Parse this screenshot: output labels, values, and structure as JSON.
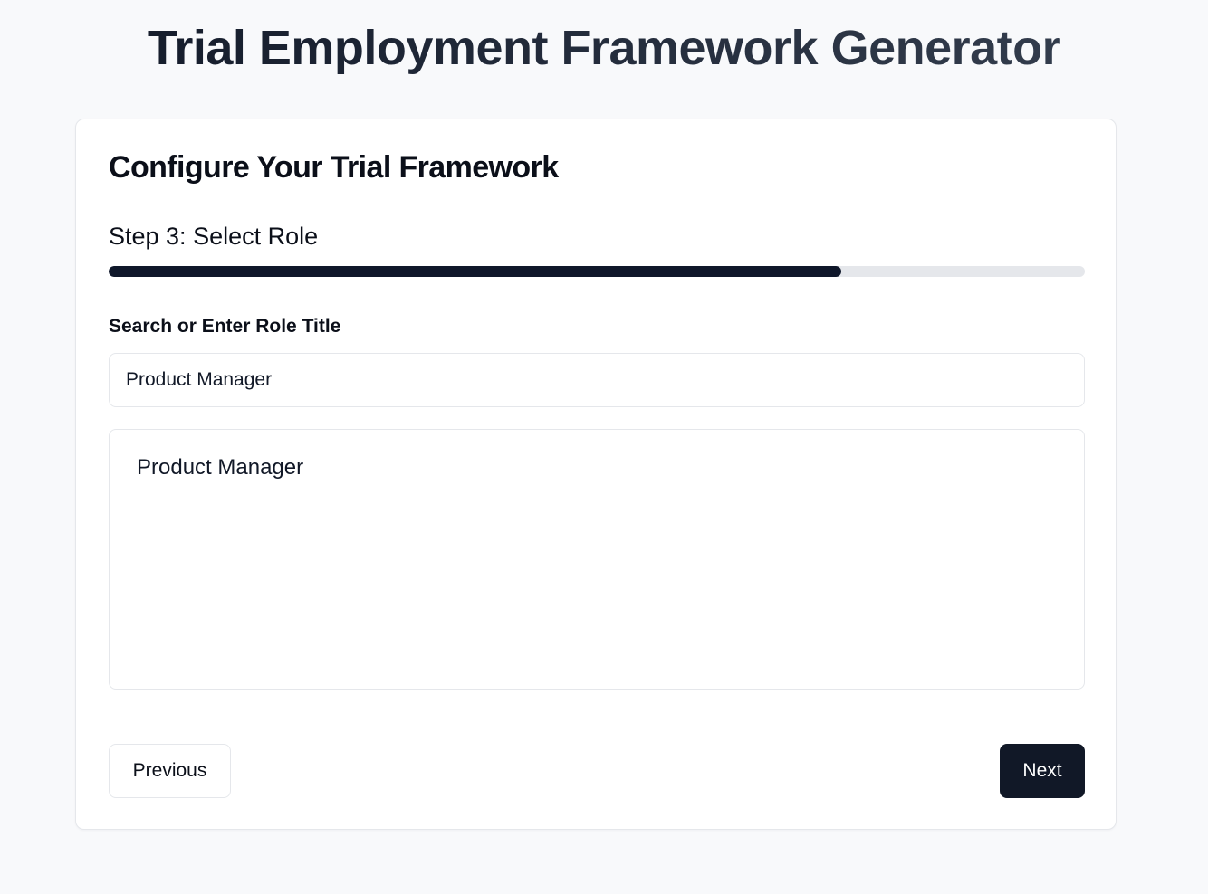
{
  "header": {
    "title": "Trial Employment Framework Generator"
  },
  "card": {
    "title": "Configure Your Trial Framework",
    "step_label": "Step 3: Select Role",
    "progress_percent": 75
  },
  "role_field": {
    "label": "Search or Enter Role Title",
    "value": "Product Manager"
  },
  "suggestions": [
    "Product Manager"
  ],
  "nav": {
    "previous_label": "Previous",
    "next_label": "Next"
  },
  "colors": {
    "primary": "#111827",
    "progress_track": "#e5e7eb",
    "background": "#f8f9fb"
  }
}
